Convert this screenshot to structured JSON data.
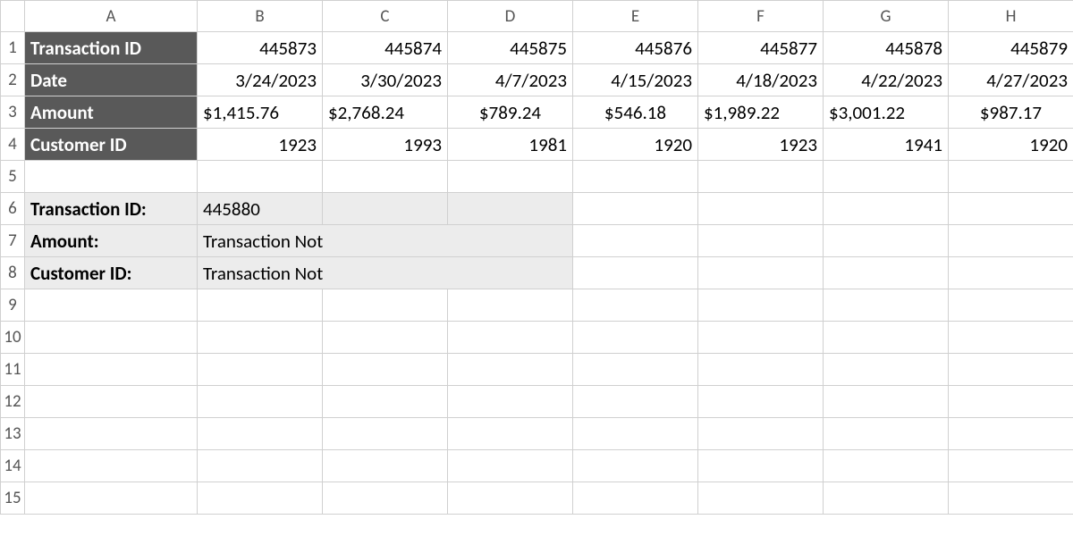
{
  "colHeaders": [
    "",
    "A",
    "B",
    "C",
    "D",
    "E",
    "F",
    "G",
    "H"
  ],
  "rowCount": 15,
  "rowHeaders": {
    "r1": "Transaction ID",
    "r2": "Date",
    "r3": "Amount",
    "r4": "Customer ID"
  },
  "data": {
    "transactionID": [
      "445873",
      "445874",
      "445875",
      "445876",
      "445877",
      "445878",
      "445879"
    ],
    "date": [
      "3/24/2023",
      "3/30/2023",
      "4/7/2023",
      "4/15/2023",
      "4/18/2023",
      "4/22/2023",
      "4/27/2023"
    ],
    "amount": [
      "$1,415.76",
      "$2,768.24",
      "$789.24",
      "$546.18",
      "$1,989.22",
      "$3,001.22",
      "$987.17"
    ],
    "customerID": [
      "1923",
      "1993",
      "1981",
      "1920",
      "1923",
      "1941",
      "1920"
    ]
  },
  "lookup": {
    "labels": {
      "tid": "Transaction ID:",
      "amount": "Amount:",
      "cid": "Customer ID:"
    },
    "tidValue": "445880",
    "amountValue": "Transaction Not Found",
    "cidValue": "Transaction Not Found"
  }
}
